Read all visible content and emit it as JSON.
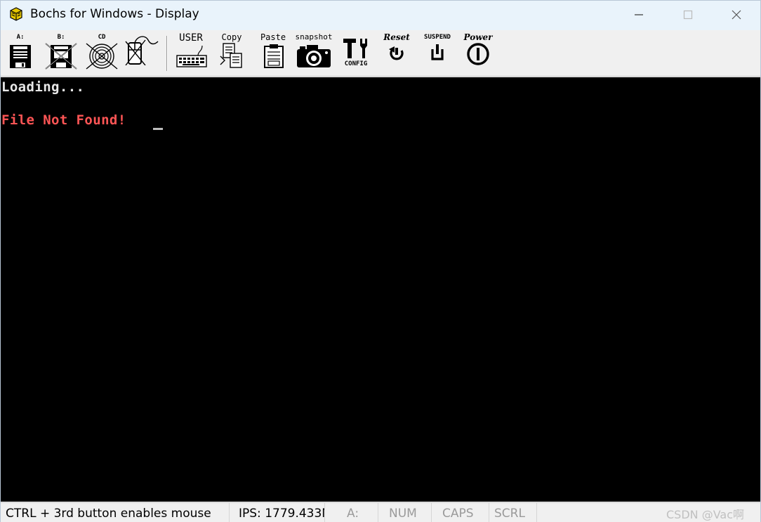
{
  "window": {
    "title": "Bochs for Windows - Display",
    "icon": "bochs-app-icon"
  },
  "titlebar_buttons": [
    {
      "name": "minimize",
      "icon": "minimize-icon"
    },
    {
      "name": "maximize",
      "icon": "maximize-icon"
    },
    {
      "name": "close",
      "icon": "close-icon"
    }
  ],
  "toolbar": {
    "floppy_a": {
      "label": "A:",
      "icon": "floppy-disk-icon"
    },
    "floppy_b": {
      "label": "B:",
      "icon": "floppy-disk-disabled-icon"
    },
    "cdrom": {
      "label": "CD",
      "icon": "cdrom-disabled-icon"
    },
    "mouse": {
      "label": "",
      "icon": "mouse-disabled-icon"
    },
    "user": {
      "label": "USER",
      "icon": "keyboard-icon"
    },
    "copy": {
      "label": "Copy",
      "icon": "copy-icon"
    },
    "paste": {
      "label": "Paste",
      "icon": "paste-icon"
    },
    "snapshot": {
      "label": "snapshot",
      "icon": "camera-icon"
    },
    "config": {
      "label": "CONFIG",
      "icon": "tools-icon"
    },
    "reset": {
      "label": "Reset",
      "icon": "reset-icon"
    },
    "suspend": {
      "label": "SUSPEND",
      "icon": "suspend-icon"
    },
    "power": {
      "label": "Power",
      "icon": "power-icon"
    }
  },
  "display": {
    "lines": [
      "Loading...",
      "File Not Found!"
    ],
    "text_color": "#e8e8e8",
    "error_color": "#ff5555",
    "background": "#000000"
  },
  "statusbar": {
    "mouse_hint": "CTRL + 3rd button enables mouse",
    "ips": "IPS: 1779.433M",
    "drive": "A:",
    "num": "NUM",
    "caps": "CAPS",
    "scrl": "SCRL",
    "watermark": "CSDN @Vac啊"
  }
}
